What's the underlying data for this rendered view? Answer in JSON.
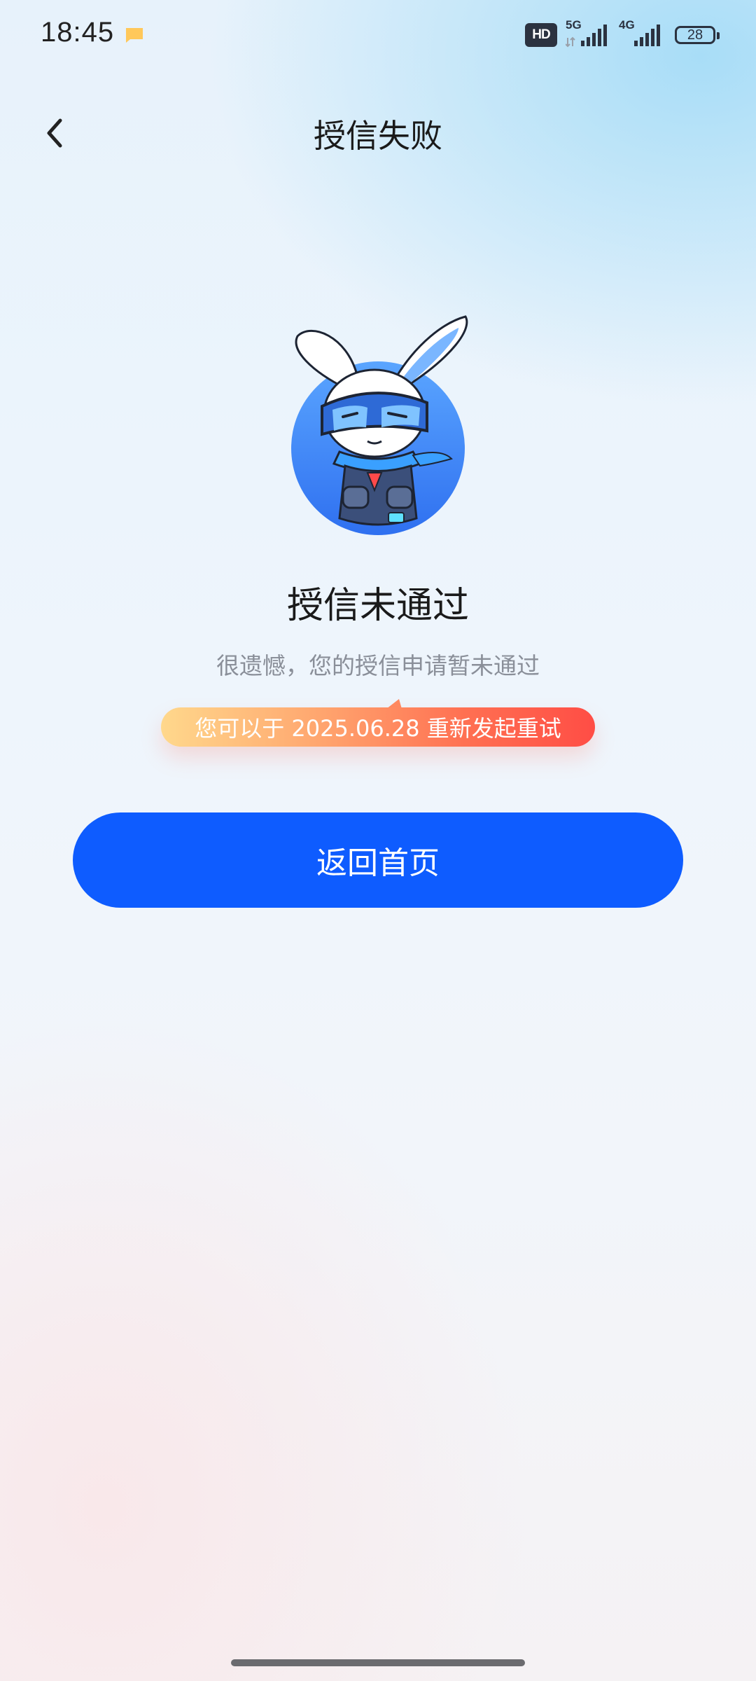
{
  "status_bar": {
    "time": "18:45",
    "hd_label": "HD",
    "net1_label": "5G",
    "net2_label": "4G",
    "battery_level": "28"
  },
  "nav": {
    "title": "授信失败",
    "back_icon": "chevron-left-icon"
  },
  "result": {
    "title": "授信未通过",
    "description": "很遗憾，您的授信申请暂未通过",
    "retry_notice": "您可以于 2025.06.28 重新发起重试"
  },
  "actions": {
    "home_button_label": "返回首页"
  },
  "colors": {
    "primary": "#0e5cff",
    "pill_start": "#ffd88c",
    "pill_end": "#ff4d45"
  }
}
